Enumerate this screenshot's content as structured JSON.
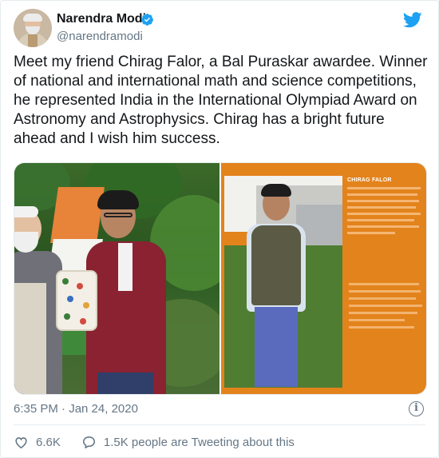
{
  "author": {
    "name": "Narendra Modi",
    "handle": "@narendramodi",
    "verified_icon": "verified-badge-icon",
    "avatar_icon": "profile-avatar"
  },
  "brand": {
    "icon": "twitter-bird-icon",
    "color": "#1da1f2"
  },
  "tweet": {
    "lines": [
      "Meet my friend Chirag Falor, a Bal Puraskar awardee. Winner",
      "of national and international math and science competitions,",
      "he represented India in the International Olympiad Award on",
      "Astronomy and Astrophysics. Chirag has a bright future",
      "ahead and I wish him success."
    ]
  },
  "media": {
    "poster_title": "CHIRAG FALOR"
  },
  "meta": {
    "timestamp": "6:35 PM · Jan 24, 2020",
    "info_icon": "info-icon",
    "info_glyph": "i"
  },
  "actions": {
    "like_count": "6.6K",
    "like_icon": "heart-icon",
    "reply_text": "1.5K people are Tweeting about this",
    "reply_icon": "speech-bubble-icon"
  },
  "colors": {
    "text": "#14171a",
    "secondary": "#657786",
    "accent": "#1da1f2",
    "poster_orange": "#e3831c"
  }
}
